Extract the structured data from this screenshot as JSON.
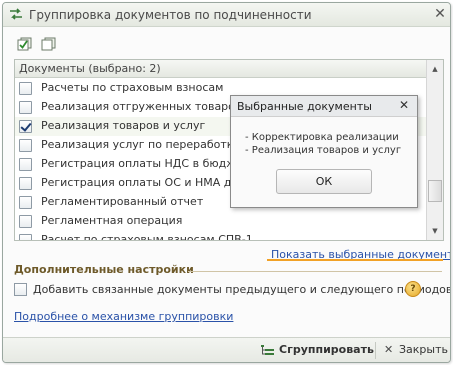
{
  "window": {
    "title": "Группировка документов по подчиненности",
    "close_glyph": "✕"
  },
  "toolbar": {
    "icons": [
      "check-all-icon",
      "uncheck-all-icon"
    ]
  },
  "list": {
    "header": "Документы (выбрано: 2)",
    "rows": [
      {
        "label": "Расчеты по страховым взносам",
        "checked": false
      },
      {
        "label": "Реализация отгруженных товаров",
        "checked": false
      },
      {
        "label": "Реализация товаров и услуг",
        "checked": true
      },
      {
        "label": "Реализация услуг по переработке",
        "checked": false
      },
      {
        "label": "Регистрация оплаты НДС в бюджет",
        "checked": false
      },
      {
        "label": "Регистрация оплаты ОС и НМА для УСН",
        "checked": false
      },
      {
        "label": "Регламентированный отчет",
        "checked": false
      },
      {
        "label": "Регламентная операция",
        "checked": false
      },
      {
        "label": "Расчет по страховым взносам СПВ-1",
        "checked": false
      }
    ]
  },
  "show_selected_link": "Показать выбранные документы",
  "additional": {
    "section_title": "Дополнительные настройки",
    "checkbox_label": "Добавить связанные документы предыдущего и следующего периодов",
    "help_glyph": "?"
  },
  "more_link": "Подробнее о механизме группировки",
  "bottom": {
    "group_button": "Сгруппировать",
    "close_button": "Закрыть"
  },
  "popup": {
    "title": "Выбранные документы",
    "close_glyph": "✕",
    "lines": [
      "- Корректировка реализации",
      "- Реализация товаров и услуг"
    ],
    "ok_label": "ОК"
  },
  "colors": {
    "link": "#2a52a8",
    "accent_underline": "#f1a126",
    "section_title": "#6e5a2a"
  }
}
